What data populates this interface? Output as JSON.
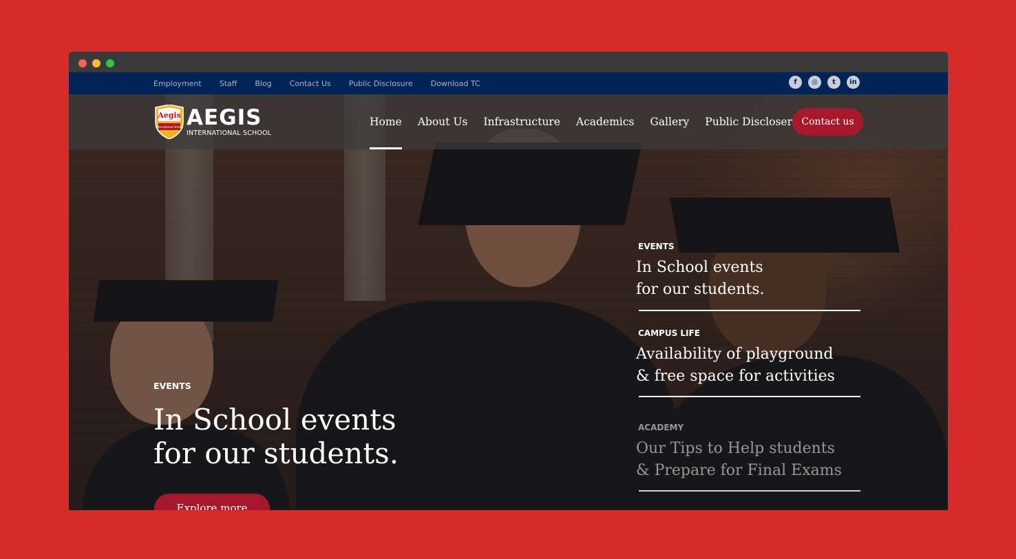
{
  "top_links": [
    "Employment",
    "Staff",
    "Blog",
    "Contact Us",
    "Public Disclosure",
    "Download TC"
  ],
  "social_icons": [
    "facebook-icon",
    "instagram-icon",
    "twitter-icon",
    "linkedin-icon"
  ],
  "social_glyphs": [
    "f",
    "◎",
    "t",
    "in"
  ],
  "logo": {
    "badge_text": "Aegis",
    "badge_sub": "International School",
    "title": "AEGIS",
    "subtitle": "INTERNATIONAL SCHOOL"
  },
  "nav": {
    "items": [
      "Home",
      "About Us",
      "Infrastructure",
      "Academics",
      "Gallery",
      "Public Discloser"
    ],
    "active": "Home",
    "contact_label": "Contact us"
  },
  "hero": {
    "kicker": "EVENTS",
    "title": "In School events for our students.",
    "button": "Explore more"
  },
  "side_items": [
    {
      "kicker": "EVENTS",
      "title": "In School events\nfor our students.",
      "state": "active"
    },
    {
      "kicker": "CAMPUS LIFE",
      "title": "Availability of playground\n& free space for activities",
      "state": "active"
    },
    {
      "kicker": "ACADEMY",
      "title": "Our Tips to Help students\n& Prepare for Final Exams",
      "state": "dimmed"
    }
  ],
  "colors": {
    "page_background": "#d62b2b",
    "topbar": "#002457",
    "accent": "#a7182d"
  }
}
